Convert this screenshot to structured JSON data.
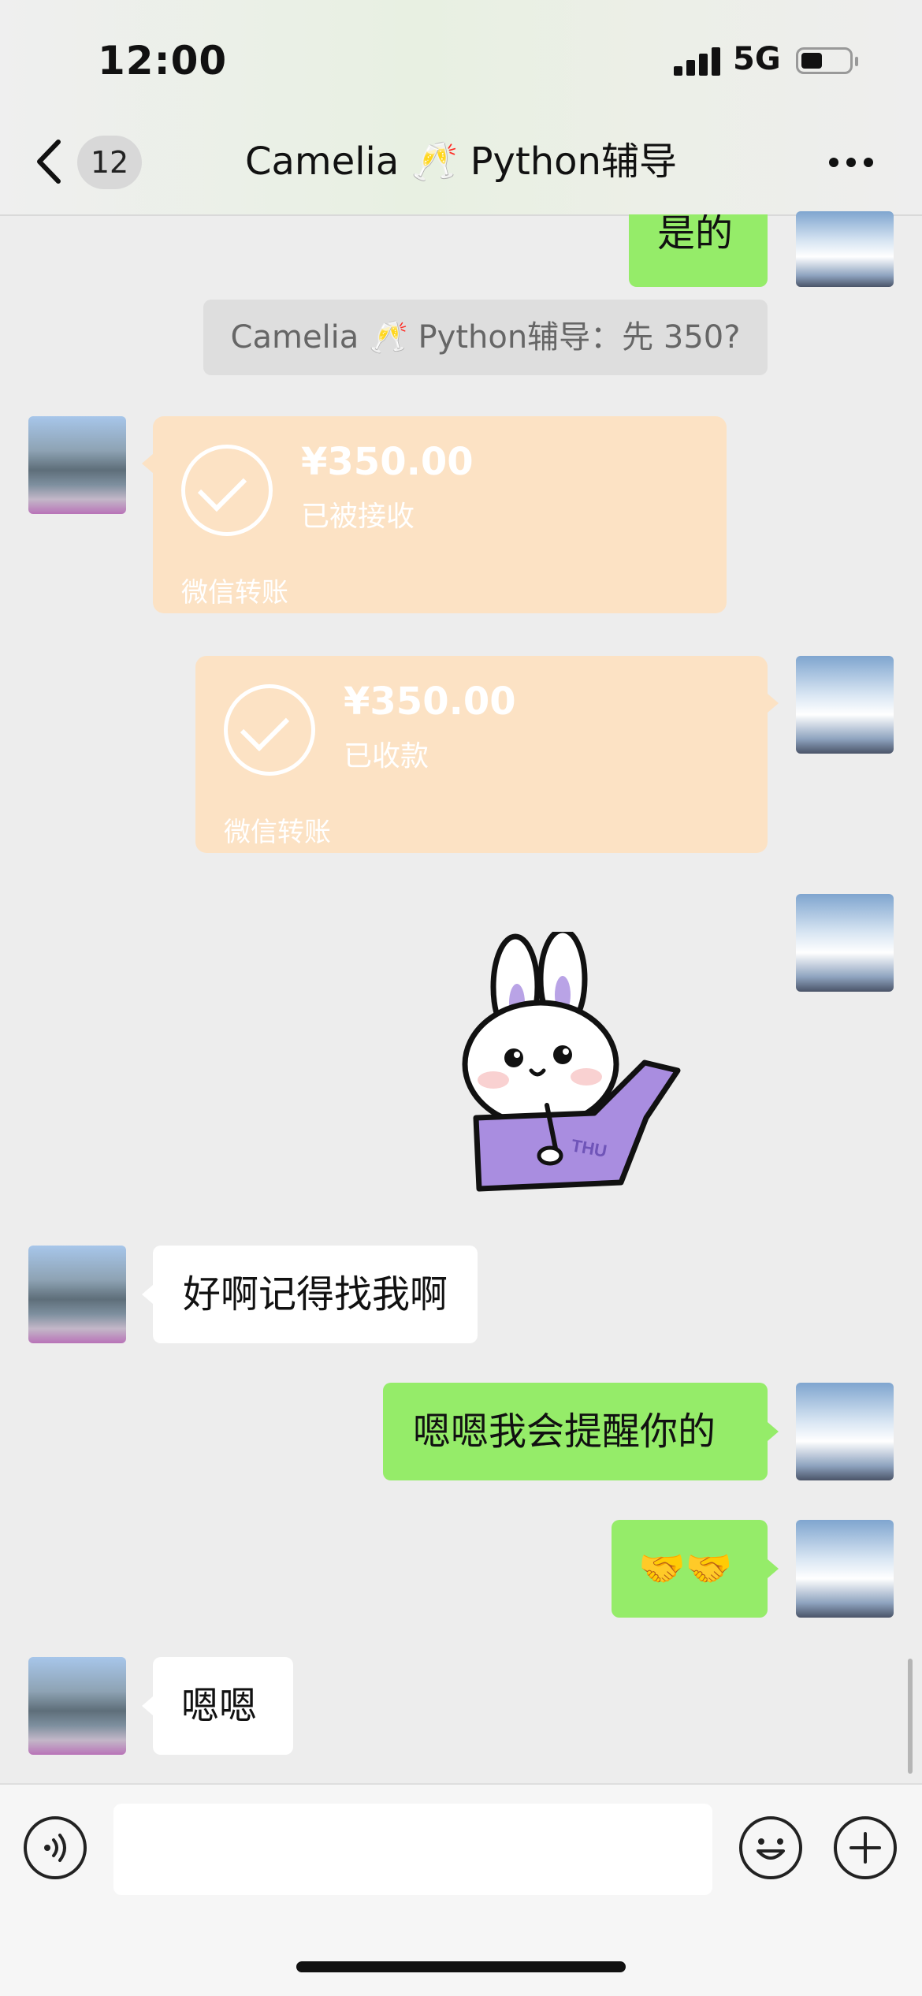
{
  "status_bar": {
    "time": "12:00",
    "network": "5G"
  },
  "header": {
    "back_count": "12",
    "title": "Camelia 🥂 Python辅导"
  },
  "messages": {
    "m1_text": "是的",
    "system_text": "Camelia 🥂 Python辅导：先 350?",
    "transfer_received": {
      "amount": "¥350.00",
      "status": "已被接收",
      "source": "微信转账"
    },
    "transfer_sent": {
      "amount": "¥350.00",
      "status": "已收款",
      "source": "微信转账"
    },
    "sticker_text": "THU",
    "m_left_1": "好啊记得找我啊",
    "m_right_2": "嗯嗯我会提醒你的",
    "m_right_3": "🤝🤝",
    "m_left_2": "嗯嗯"
  },
  "input": {
    "value": ""
  },
  "colors": {
    "outgoing_bubble": "#95ec69",
    "incoming_bubble": "#ffffff",
    "transfer_card": "#fce2c4",
    "chat_bg": "#ededed"
  },
  "icons": [
    "back-icon",
    "more-icon",
    "voice-icon",
    "emoji-icon",
    "plus-icon",
    "check-icon"
  ]
}
